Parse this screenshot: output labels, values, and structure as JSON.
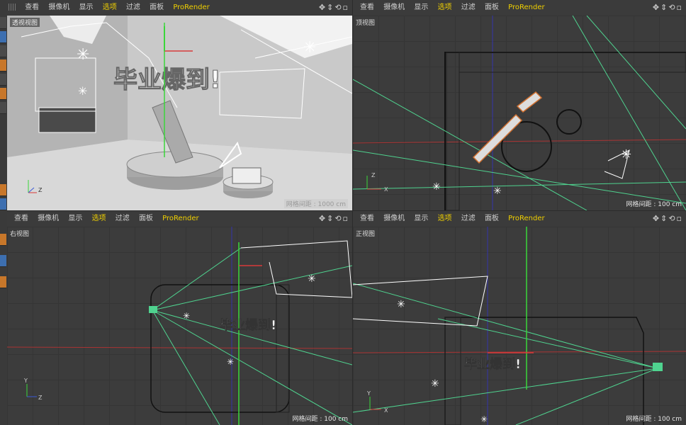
{
  "viewports": [
    {
      "id": "perspective",
      "menu": [
        "查看",
        "摄像机",
        "显示",
        "选项",
        "过滤",
        "面板",
        "ProRender"
      ],
      "active": "选项",
      "title": "透视视图",
      "grid_spacing": "网格间距 : 1000 cm",
      "banner_text": "毕业爆到!"
    },
    {
      "id": "top",
      "menu": [
        "查看",
        "摄像机",
        "显示",
        "选项",
        "过滤",
        "面板",
        "ProRender"
      ],
      "active": "选项",
      "title": "顶视图",
      "grid_spacing": "网格间距 : 100 cm"
    },
    {
      "id": "right",
      "menu": [
        "查看",
        "摄像机",
        "显示",
        "选项",
        "过滤",
        "面板",
        "ProRender"
      ],
      "active": "选项",
      "title": "右视图",
      "grid_spacing": "网格间距 : 100 cm"
    },
    {
      "id": "front",
      "menu": [
        "查看",
        "摄像机",
        "显示",
        "选项",
        "过滤",
        "面板",
        "ProRender"
      ],
      "active": "选项",
      "title": "正视图",
      "grid_spacing": "网格间距 : 100 cm"
    }
  ],
  "viewport_controls": [
    "move-icon",
    "pan-icon",
    "rotate-icon",
    "maximize-icon"
  ],
  "axis_labels": {
    "x": "X",
    "y": "Y",
    "z": "Z"
  },
  "colors": {
    "accent": "#f0d000",
    "axis_x": "#d83a3a",
    "axis_y": "#3ad63a",
    "axis_z": "#3a5ad8",
    "camera_lines": "#4fd38f"
  }
}
